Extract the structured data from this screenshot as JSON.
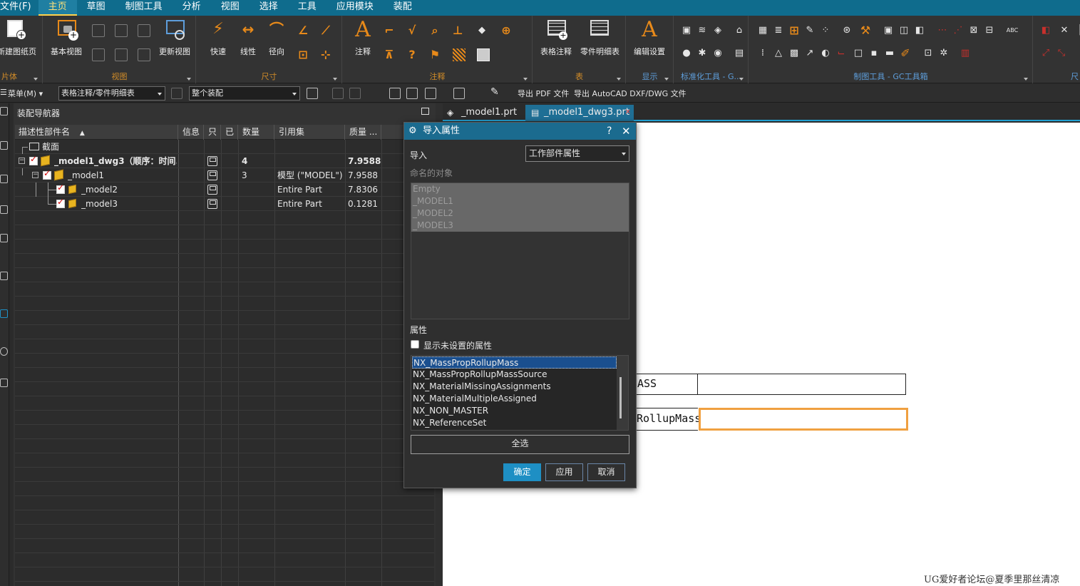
{
  "menu": {
    "file": "文件(F)",
    "tabs": [
      "主页",
      "草图",
      "制图工具",
      "分析",
      "视图",
      "选择",
      "工具",
      "应用模块",
      "装配"
    ],
    "active_tab": "主页"
  },
  "ribbon": {
    "groups": {
      "sheet": "片体",
      "view": "视图",
      "dimension": "尺寸",
      "annotation": "注释",
      "table": "表",
      "display": "显示",
      "std_tools": "标准化工具 - G...",
      "gc_tools": "制图工具 - GC工具箱",
      "last": "尺"
    },
    "buttons": {
      "new_sheet": "新建图纸页",
      "base_view": "基本视图",
      "update_view": "更新视图",
      "rapid": "快速",
      "linear": "线性",
      "radial": "径向",
      "note": "注释",
      "table_note": "表格注释",
      "parts_list": "零件明细表",
      "edit_settings": "编辑设置"
    },
    "annotation_letter": "A"
  },
  "toolbar": {
    "menu_label": "菜单(M)",
    "filter_combo": "表格注释/零件明细表",
    "scope_combo": "整个装配",
    "export_pdf": "导出 PDF 文件",
    "export_dwg": "导出 AutoCAD DXF/DWG 文件"
  },
  "navigator": {
    "title": "装配导航器",
    "columns": [
      "描述性部件名",
      "信息",
      "只",
      "已",
      "数量",
      "引用集",
      "质量 ..."
    ],
    "rows": [
      {
        "name": "截面",
        "qty": "",
        "refset": "",
        "mass": ""
      },
      {
        "name": "_model1_dwg3（顺序：时间...",
        "qty": "4",
        "refset": "",
        "mass": "7.9588"
      },
      {
        "name": "_model1",
        "qty": "3",
        "refset": "模型 (\"MODEL\")",
        "mass": "7.9588"
      },
      {
        "name": "_model2",
        "qty": "",
        "refset": "Entire Part",
        "mass": "7.8306"
      },
      {
        "name": "_model3",
        "qty": "",
        "refset": "Entire Part",
        "mass": "0.1281"
      }
    ]
  },
  "tabs": [
    {
      "label": "_model1.prt",
      "active": false
    },
    {
      "label": "_model1_dwg3.prt",
      "active": true
    }
  ],
  "canvas": {
    "cell1_text": "ASS",
    "cell2_text": "RollupMass",
    "watermark": "UG爱好者论坛@夏季里那丝清凉"
  },
  "dialog": {
    "title": "导入属性",
    "help": "?",
    "close": "✕",
    "import_label": "导入",
    "import_value": "工作部件属性",
    "named_objects_label": "命名的对象",
    "named_objects": [
      "Empty",
      "_MODEL1",
      "_MODEL2",
      "_MODEL3"
    ],
    "attributes_label": "属性",
    "show_unset_label": "显示未设置的属性",
    "attributes": [
      "NX_MassPropRollupMass",
      "NX_MassPropRollupMassSource",
      "NX_MaterialMissingAssignments",
      "NX_MaterialMultipleAssigned",
      "NX_NON_MASTER",
      "NX_ReferenceSet"
    ],
    "select_all": "全选",
    "ok": "确定",
    "apply": "应用",
    "cancel": "取消"
  },
  "colors": {
    "menubar": "#0f6c8d",
    "accent_orange": "#e88a1a",
    "primary_button": "#1e8fc4",
    "selected_cell_border": "#f0a040"
  }
}
